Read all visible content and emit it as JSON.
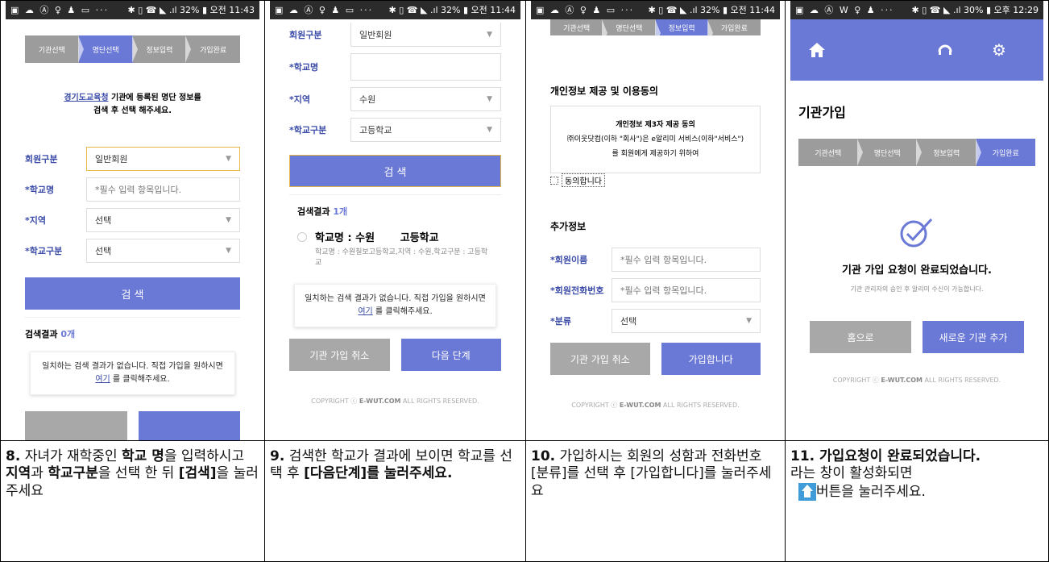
{
  "status_bars": [
    {
      "icons": "▣ ☁ Ⓐ ♀ ♟ ▭ ···",
      "right": "✱ ▯ ☎ ◣ .ıl 32% ▮ 오전 11:43"
    },
    {
      "icons": "▣ ☁ Ⓐ ♀ ♟ ▭ ···",
      "right": "✱ ▯ ☎ ◣ .ıl 32% ▮ 오전 11:44"
    },
    {
      "icons": "▣ ☁ Ⓐ ♀ ♟ ▭ ···",
      "right": "✱ ▯ ☎ ◣ .ıl 32% ▮ 오전 11:44"
    },
    {
      "icons": "▣ ☁ Ⓐ W ♀ ♟ ···",
      "right": "✱ ▯ ☎ ◣ .ıl 30% ▮ 오후 12:29"
    }
  ],
  "steps": [
    "기관선택",
    "명단선택",
    "정보입력",
    "가입완료"
  ],
  "panel1": {
    "intro_link": "경기도교육청",
    "intro_rest": " 기관에 등록된 명단 정보를",
    "intro_line2": "검색 후 선택 해주세요.",
    "fields": [
      {
        "label": "회원구분",
        "value": "일반회원",
        "type": "select",
        "focus": true
      },
      {
        "label": "*학교명",
        "value": "*필수 입력 항목입니다.",
        "type": "input"
      },
      {
        "label": "*지역",
        "value": "선택",
        "type": "select"
      },
      {
        "label": "*학교구분",
        "value": "선택",
        "type": "select"
      }
    ],
    "search_button": "검 색",
    "results_label": "검색결과",
    "results_count": "0개",
    "noresult_line1": "일치하는 검색 결과가 없습니다. 직접 가입을 원하시면",
    "noresult_link": "여기",
    "noresult_line2": " 를 클릭해주세요."
  },
  "panel2": {
    "fields": [
      {
        "label": "회원구분",
        "value": "일반회원",
        "type": "select"
      },
      {
        "label": "*학교명",
        "value": "",
        "type": "input"
      },
      {
        "label": "*지역",
        "value": "수원",
        "type": "select"
      },
      {
        "label": "*학교구분",
        "value": "고등학교",
        "type": "select"
      }
    ],
    "search_button": "검 색",
    "results_label": "검색결과",
    "results_count": "1개",
    "result_title": "학교명 : 수원       고등학교",
    "result_detail": "학교명 : 수원칠보고등학교,지역 : 수원,학교구분 : 고등학교",
    "noresult_line1": "일치하는 검색 결과가 없습니다. 직접 가입을 원하시면",
    "noresult_link": "여기",
    "noresult_line2": " 를 클릭해주세요.",
    "cancel_button": "기관 가입 취소",
    "next_button": "다음 단계",
    "copyright_pre": "COPYRIGHT ⓒ ",
    "copyright_brand": "E-WUT.COM",
    "copyright_post": " ALL RIGHTS RESERVED."
  },
  "panel3": {
    "consent_title": "개인정보 제공 및 이용동의",
    "consent_box_title": "개인정보 제3자 제공 동의",
    "consent_box_line1": "㈜이웃닷컴(이하 \"회사\")은 e알리미 서비스(이하\"서비스\")",
    "consent_box_line2": "를 회원에게 제공하기 위하여",
    "agree_label": "동의합니다",
    "extra_title": "추가정보",
    "fields": [
      {
        "label": "*회원이름",
        "value": "*필수 입력 항목입니다.",
        "type": "input"
      },
      {
        "label": "*회원전화번호",
        "value": "*필수 입력 항목입니다.",
        "type": "input"
      },
      {
        "label": "*분류",
        "value": "선택",
        "type": "select"
      }
    ],
    "cancel_button": "기관 가입 취소",
    "join_button": "가입합니다",
    "copyright_pre": "COPYRIGHT ⓒ ",
    "copyright_brand": "E-WUT.COM",
    "copyright_post": " ALL RIGHTS RESERVED."
  },
  "panel4": {
    "page_title": "기관가입",
    "complete_message": "기관 가입 요청이 완료되었습니다.",
    "complete_sub": "기관 관리자의 승인 후 알리미 수신이 가능합니다.",
    "home_button": "홈으로",
    "add_button": "새로운 기관 추가",
    "copyright_pre": "COPYRIGHT ⓒ ",
    "copyright_brand": "E-WUT.COM",
    "copyright_post": " ALL RIGHTS RESERVED."
  },
  "captions": {
    "c8_num": "8.",
    "c8_a": " 자녀가 재학중인 ",
    "c8_b": "학교 명",
    "c8_c": "을 입력하시고 ",
    "c8_d": "지역",
    "c8_e": "과 ",
    "c8_f": "학교구분",
    "c8_g": "을 선택 한 뒤 ",
    "c8_h": "[검색]",
    "c8_i": "을 눌러주세요",
    "c9_num": "9.",
    "c9_a": " 검색한 학교가 결과에 보이면 학교를 선택 후 ",
    "c9_b": "[다음단계]를 눌러주세요.",
    "c10_num": "10.",
    "c10_a": " 가입하시는 회원의 성함과 전화번호 [분류]를 선택 후 [가입합니다]를 눌러주세요",
    "c11_a": "11. 가입요청이 완료되었습니다.",
    "c11_b": "라는 창이 활성화되면",
    "c11_c": "버튼을 눌러주세요."
  },
  "colors": {
    "accent": "#6a78d6",
    "label": "#3b4ba8",
    "gray_button": "#a8a8a8",
    "home_icon": "#3f9cd8"
  }
}
